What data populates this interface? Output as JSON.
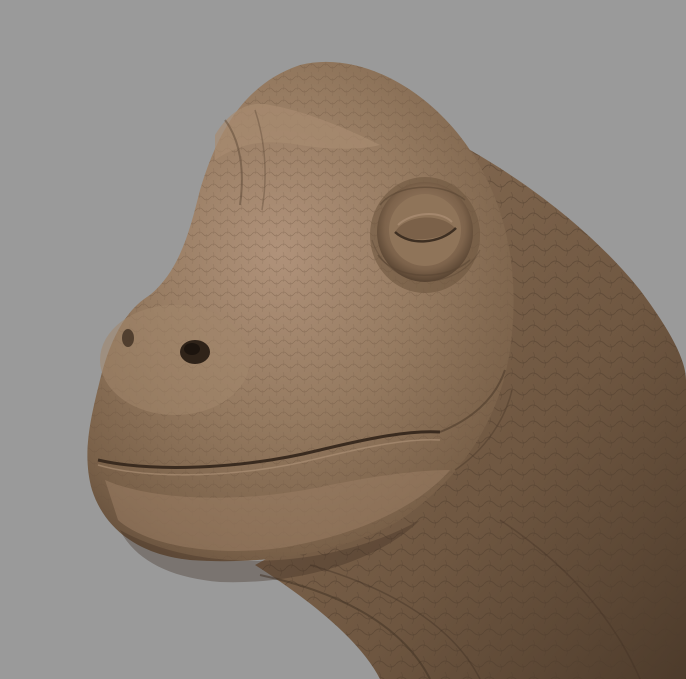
{
  "scene": {
    "subject": "sculpted-dinosaur-head",
    "colors": {
      "background": "#9a9a9a",
      "clay_base": "#8a6f55",
      "clay_light": "#a98b6e",
      "clay_dark": "#5a4634",
      "clay_shadow": "#3e2f22"
    }
  }
}
